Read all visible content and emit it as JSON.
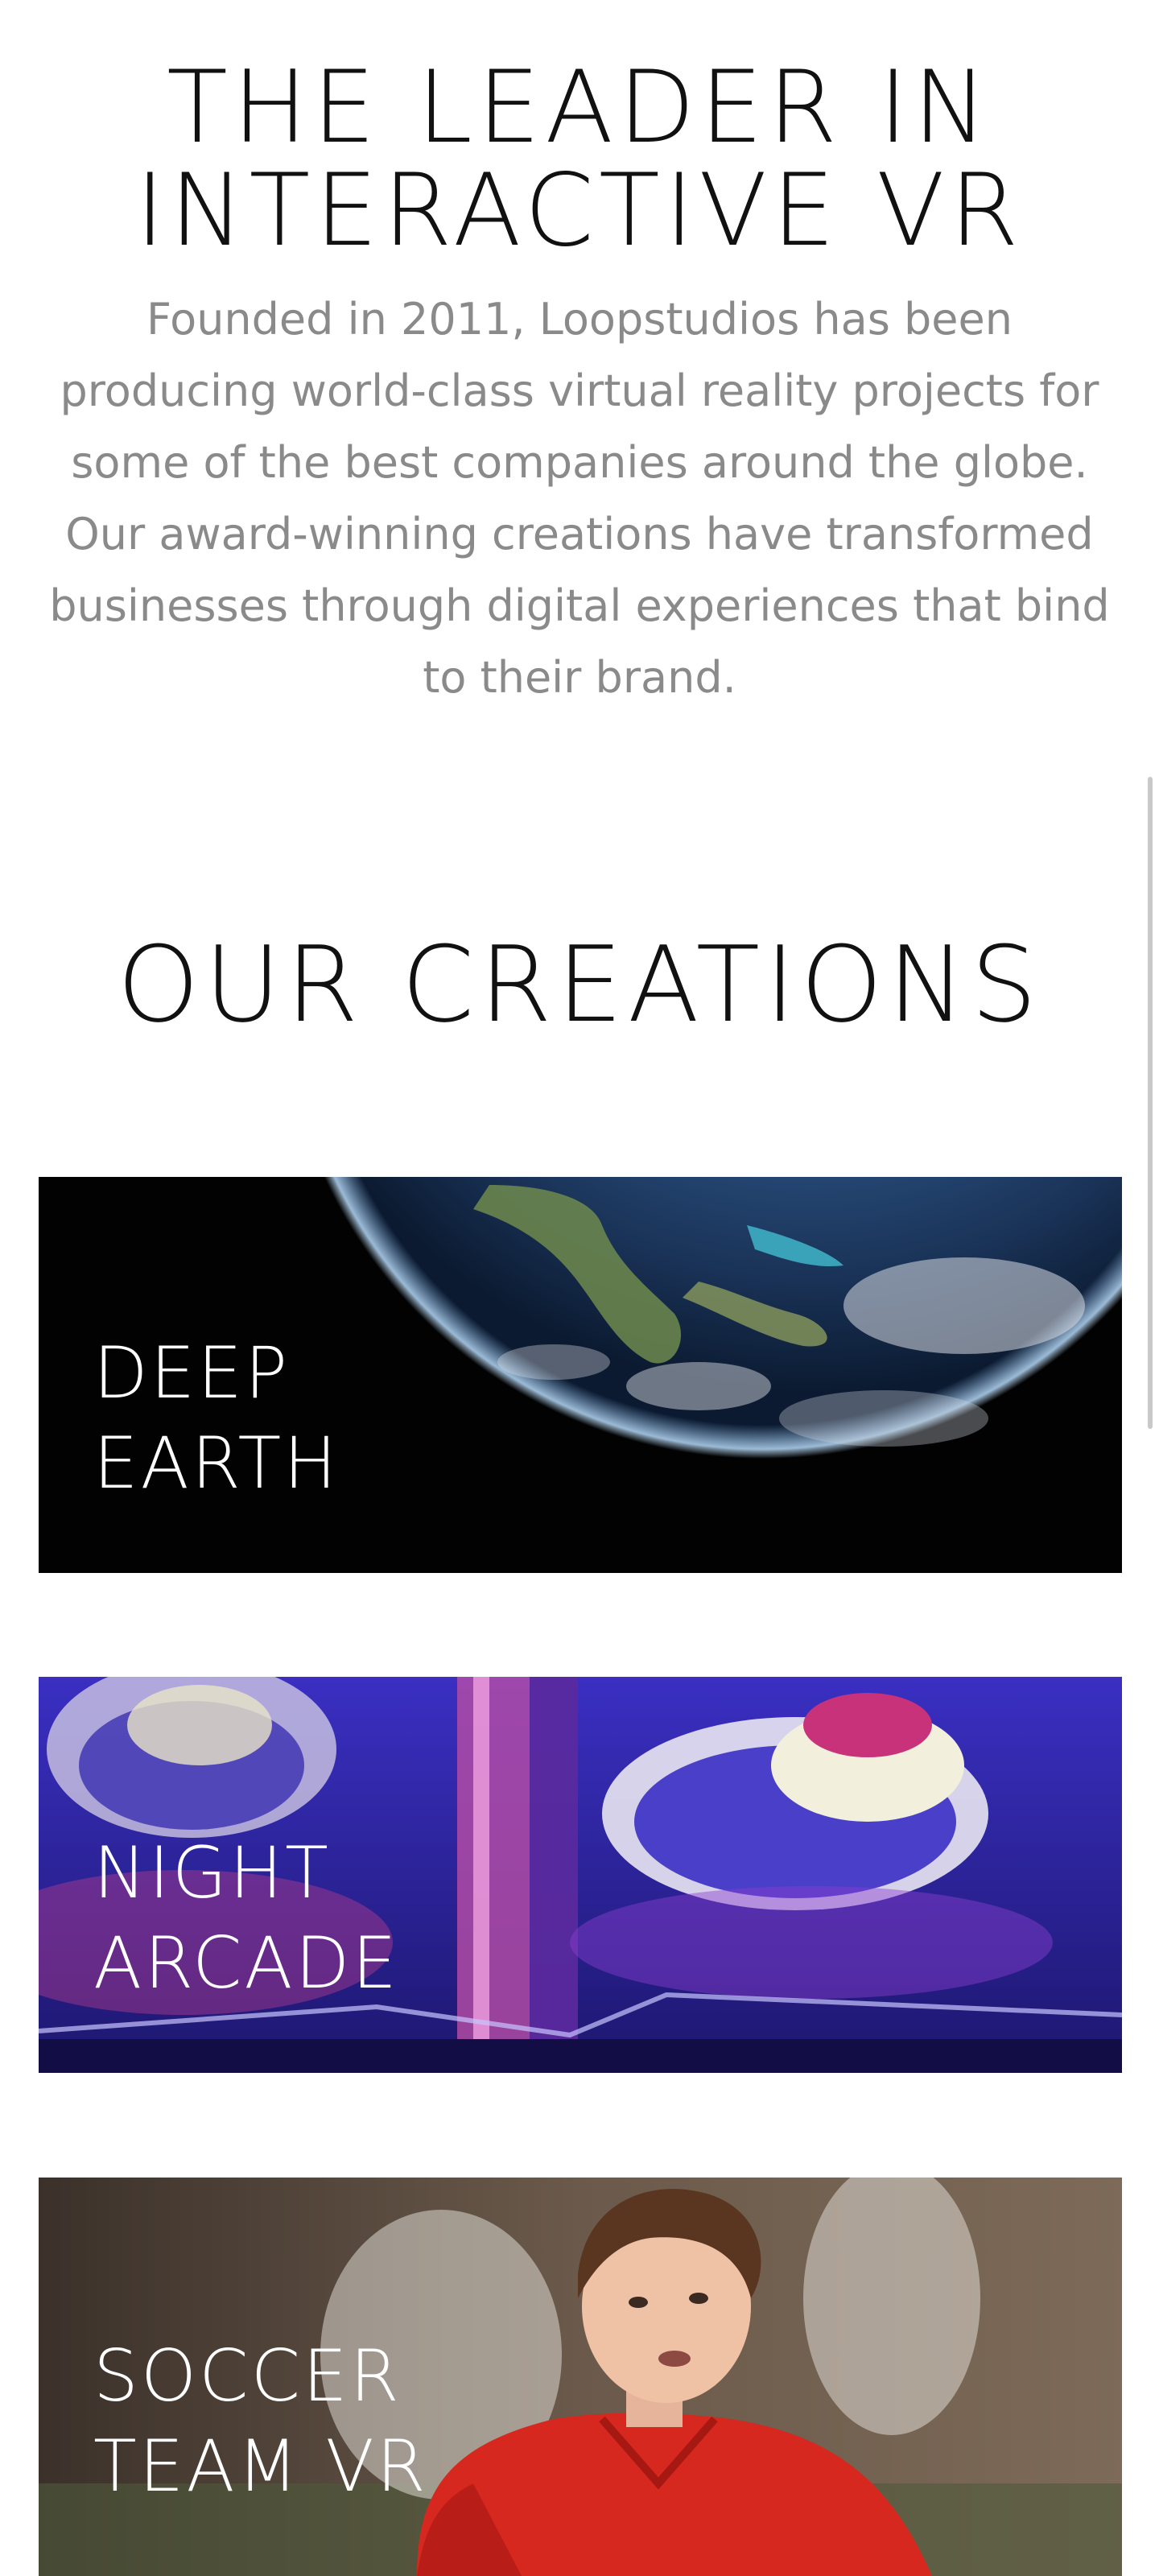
{
  "leader": {
    "title": "THE LEADER IN INTERACTIVE VR",
    "description": "Founded in 2011, Loopstudios has been producing world-class virtual reality projects for some of the best companies around the globe. Our award-winning creations have transformed businesses through digital experiences that bind to their brand."
  },
  "creations": {
    "title": "OUR CREATIONS",
    "items": [
      {
        "label": "DEEP\nEARTH"
      },
      {
        "label": "NIGHT\nARCADE"
      },
      {
        "label": "SOCCER\nTEAM VR"
      }
    ]
  },
  "colors": {
    "heading": "#111111",
    "body_text": "#8a8a8a",
    "card_label": "#ffffff"
  }
}
